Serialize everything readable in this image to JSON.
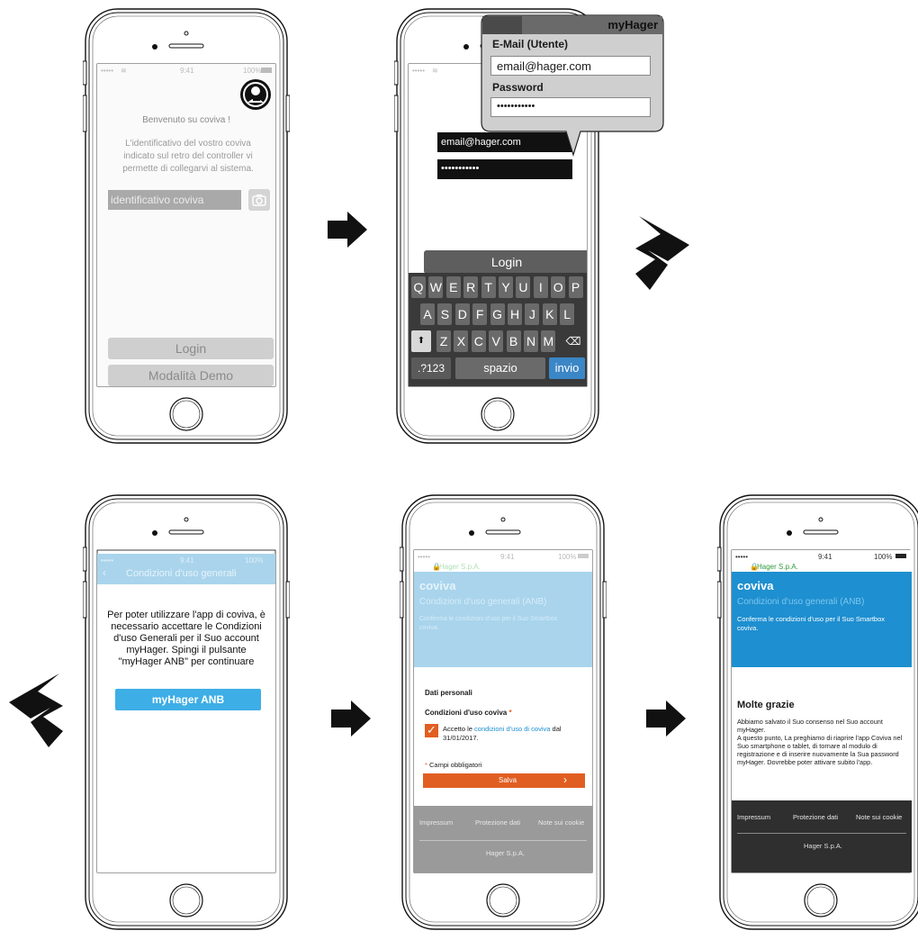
{
  "colors": {
    "hager_blue": "#1e8fd0",
    "hager_blue_faded": "#a9d4ec",
    "myhager_button": "#3eaee6",
    "salva_orange": "#e15e22",
    "footer_grey": "#9a9a9a",
    "footer_dark": "#2f2f2f",
    "keyboard": "#3a3a3a",
    "invio_key": "#3b86c6"
  },
  "icons": [
    "user-wrench-icon",
    "camera-icon",
    "wifi-icon",
    "battery-icon",
    "lock-icon",
    "shift-icon",
    "backspace-icon",
    "chevron-left-icon",
    "chevron-right-icon",
    "checkmark-icon",
    "arrow-right-icon",
    "hager-logo-icon"
  ],
  "step1": {
    "status_time": "9:41",
    "status_battery": "100%",
    "welcome": "Benvenuto su coviva !",
    "description": "L'identificativo del vostro coviva indicato sul retro del controller vi permette di collegarvi al sistema.",
    "id_placeholder": "identificativo coviva",
    "login_label": "Login",
    "demo_label": "Modalità Demo"
  },
  "step2": {
    "email_value": "email@hager.com",
    "password_value": "•••••••••••",
    "login_label": "Login",
    "bubble": {
      "title": "myHager",
      "email_label": "E-Mail (Utente)",
      "email_value": "email@hager.com",
      "password_label": "Password",
      "password_value": "•••••••••••"
    },
    "keyboard": {
      "row1": [
        "Q",
        "W",
        "E",
        "R",
        "T",
        "Y",
        "U",
        "I",
        "O",
        "P"
      ],
      "row2": [
        "A",
        "S",
        "D",
        "F",
        "G",
        "H",
        "J",
        "K",
        "L"
      ],
      "row3": [
        "Z",
        "X",
        "C",
        "V",
        "B",
        "N",
        "M"
      ],
      "numbers_label": ".?123",
      "space_label": "spazio",
      "enter_label": "invio"
    }
  },
  "step3": {
    "status_time": "9:41",
    "status_battery": "100%",
    "nav_title": "Condizioni d'uso generali",
    "body_text": "Per poter utilizzare l'app di coviva, è necessario accettare le Condizioni d'uso Generali per il Suo account myHager. Spingi il pulsante \"myHager ANB\" per continuare",
    "button_label": "myHager ANB"
  },
  "step4": {
    "status_time": "9:41",
    "status_battery": "100%",
    "site": "Hager S.p.A.",
    "brand": "coviva",
    "title": "Condizioni d'uso generali (ANB)",
    "subtitle": "Conferma le condizioni d'uso per il Suo Smartbox coviva.",
    "section_title": "Dati personali",
    "terms_label": "Condizioni d'uso coviva",
    "required_star": "*",
    "checkbox_text_prefix": "Accetto le ",
    "checkbox_link": "condizioni d'uso di coviva",
    "checkbox_text_suffix": " dal 31/01/2017.",
    "required_note": "Campi obbligatori",
    "save_label": "Salva",
    "footer_links": [
      "Impressum",
      "Protezione dati",
      "Note sui cookie"
    ],
    "footer_company": "Hager S.p.A."
  },
  "step5": {
    "status_time": "9:41",
    "status_battery": "100%",
    "site": "Hager S.p.A.",
    "brand": "coviva",
    "title": "Condizioni d'uso generali (ANB)",
    "subtitle": "Conferma le condizioni d'uso per il Suo Smartbox coviva.",
    "thanks_title": "Molte grazie",
    "thanks_text": "Abbiamo salvato il Suo consenso nel Suo account myHager.\nA questo punto, La preghiamo di riaprire l'app Coviva nel Suo smartphone o tablet, di tornare al modulo di registrazione e di inserire nuovamente la Sua password myHager. Dovrebbe poter attivare subito l'app.",
    "footer_links": [
      "Impressum",
      "Protezione dati",
      "Note sui cookie"
    ],
    "footer_company": "Hager S.p.A."
  }
}
